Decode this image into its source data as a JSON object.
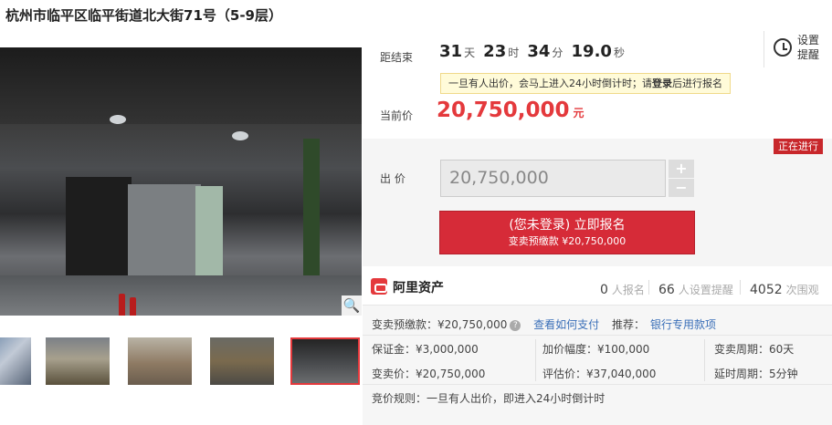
{
  "title": "杭州市临平区临平街道北大街71号（5-9层）",
  "countdown": {
    "label": "距结束",
    "days": "31",
    "days_unit": "天",
    "hours": "23",
    "hours_unit": "时",
    "minutes": "34",
    "minutes_unit": "分",
    "seconds": "19.0",
    "seconds_unit": "秒"
  },
  "reminder": {
    "label": "设置提醒"
  },
  "notice": {
    "before": "一旦有人出价，会马上进入24小时倒计时；请",
    "link": "登录",
    "after": "后进行报名"
  },
  "current_price": {
    "label": "当前价",
    "value": "20,750,000",
    "unit": "元"
  },
  "status_badge": "正在进行",
  "bid": {
    "label": "出 价",
    "value": "20,750,000",
    "plus": "+",
    "minus": "−",
    "apply_main": "(您未登录) 立即报名",
    "apply_sub": "变卖预缴款 ¥20,750,000"
  },
  "provider": {
    "name": "阿里资产"
  },
  "stats": [
    {
      "num": "0",
      "label": "人报名"
    },
    {
      "num": "66",
      "label": "人设置提醒"
    },
    {
      "num": "4052",
      "label": "次围观"
    }
  ],
  "deposit": {
    "label": "变卖预缴款：¥20,750,000",
    "help": "?",
    "pay_link": "查看如何支付",
    "recommend_label": "推荐：",
    "recommend_link": "银行专用款项"
  },
  "details": {
    "margin": "保证金：¥3,000,000",
    "increment": "加价幅度：¥100,000",
    "period": "变卖周期：60天",
    "sale_price": "变卖价：¥20,750,000",
    "appraisal": "评估价：¥37,040,000",
    "extension": "延时周期：5分钟"
  },
  "rule": "竞价规则：一旦有人出价，即进入24小时倒计时",
  "colors": {
    "accent": "#e4393c",
    "button": "#d62b38",
    "badge": "#c8272b"
  },
  "icons": [
    "zoom-icon",
    "alarm-clock-icon",
    "ali-assets-logo",
    "help-icon"
  ]
}
